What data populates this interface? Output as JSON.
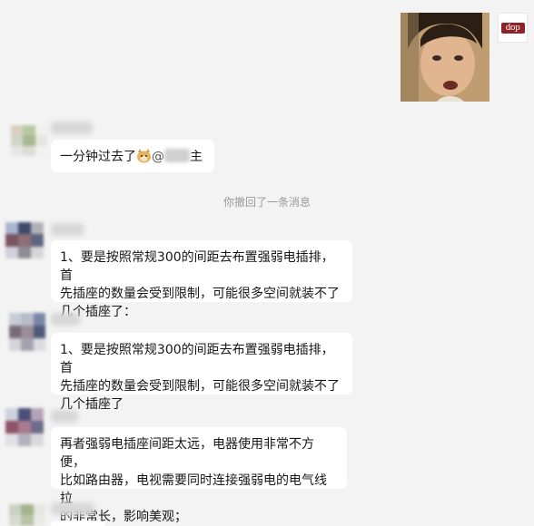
{
  "brand": {
    "text": "dop"
  },
  "messages": [
    {
      "text_before": "一分钟过去了",
      "text_after": "主"
    },
    {
      "system": "你撤回了一条消息"
    },
    {
      "lines": [
        "1、要是按照常规300的间距去布置强弱电插排，首",
        "先插座的数量会受到限制，可能很多空间就装不了",
        "几个插座了："
      ]
    },
    {
      "lines": [
        "1、要是按照常规300的间距去布置强弱电插排，首",
        "先插座的数量会受到限制，可能很多空间就装不了",
        "几个插座了"
      ]
    },
    {
      "lines": [
        "再者强弱电插座间距太远，电器使用非常不方便，",
        "比如路由器，电视需要同时连接强弱电的电气线拉",
        "的非常长，影响美观；"
      ]
    }
  ],
  "colors": {
    "background": "#f3f3f3",
    "bubble": "#ffffff",
    "system_text": "#9a9a9a",
    "brand": "#8e2226"
  },
  "icons": [
    "doge-emoji-icon",
    "at-icon"
  ]
}
